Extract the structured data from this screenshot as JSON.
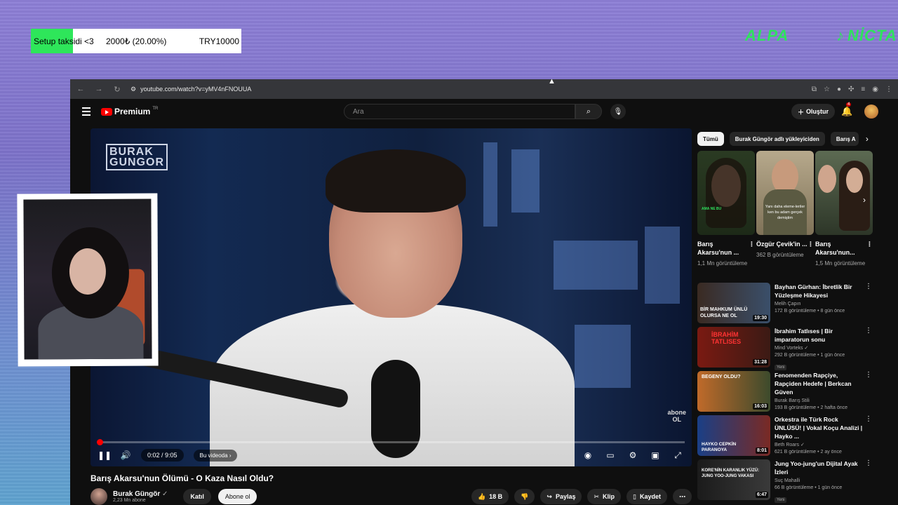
{
  "overlay": {
    "goal": {
      "label": "Setup taksidi <3",
      "amount": "2000₺ (20.00%)",
      "target": "TRY10000",
      "progress": 0.2,
      "color": "#2ee65a"
    },
    "kick_handle": "ALPA",
    "tiktok_handle": "NİCTA"
  },
  "browser": {
    "url": "youtube.com/watch?v=yMV4nFNOUUA"
  },
  "youtube": {
    "logo": "Premium",
    "logo_region": "TR",
    "search_placeholder": "Ara",
    "create_label": "Oluştur",
    "notifications_count": "4",
    "accent_color": "#ff0000"
  },
  "player": {
    "watermark_line1": "BURAK",
    "watermark_line2": "GUNGOR",
    "subscribe_badge_line1": "abone",
    "subscribe_badge_line2": "OL",
    "time": "0:02 / 9:05",
    "chapter": "Bu videoda",
    "progress": 0.004
  },
  "video_info": {
    "title": "Barış Akarsu'nun Ölümü - O Kaza Nasıl Oldu?",
    "channel": "Burak Güngör",
    "subscribers": "2,23 Mn abone",
    "join_label": "Katıl",
    "subscribe_label": "Abone ol",
    "likes": "18 B",
    "share_label": "Paylaş",
    "clip_label": "Klip",
    "save_label": "Kaydet"
  },
  "sidebar": {
    "chips": [
      "Tümü",
      "Burak Güngör adlı yükleyiciden",
      "Barış A"
    ],
    "shorts": [
      {
        "title": "Barış Akarsu'nun ...",
        "views": "1,1 Mn görüntüleme",
        "thumb_text": "AMA NE BU"
      },
      {
        "title": "Özgür Çevik'in ...",
        "views": "362 B görüntüleme",
        "thumb_text": "Yanı daha eleme-leriler ken bu adam gerçek demiştim"
      },
      {
        "title": "Barış Akarsu'nun...",
        "views": "1,5 Mn görüntüleme",
        "thumb_text": ""
      }
    ],
    "recommendations": [
      {
        "title": "Bayhan Gürhan: İbretlik Bir Yüzleşme Hikayesi",
        "channel": "Melih Çapın",
        "meta": "172 B görüntüleme • 8 gün önce",
        "duration": "19:30",
        "thumb_text": "BİR MAHKUM ÜNLÜ OLURSA NE OL",
        "is_new": false,
        "verified": false
      },
      {
        "title": "İbrahim Tatlıses | Bir imparatorun sonu",
        "channel": "Mind Vorteks",
        "meta": "292 B görüntüleme • 1 gün önce",
        "duration": "31:28",
        "thumb_text": "İBRAHİM TATLISES",
        "is_new": true,
        "verified": true
      },
      {
        "title": "Fenomenden Rapçiye, Rapçiden Hedefe | Berkcan Güven",
        "channel": "Burak Barış Stili",
        "meta": "193 B görüntüleme • 2 hafta önce",
        "duration": "16:03",
        "thumb_text": "BEGENY OLDU?",
        "is_new": false,
        "verified": false
      },
      {
        "title": "Orkestra ile Türk Rock ÜNLÜSÜ! | Vokal Koçu Analizi | Hayko ...",
        "channel": "Beth Roars",
        "meta": "621 B görüntüleme • 2 ay önce",
        "duration": "8:01",
        "thumb_text": "HAYKO CEPKİN PARANOYA",
        "is_new": false,
        "verified": true
      },
      {
        "title": "Jung Yoo-jung'un Dijital Ayak İzleri",
        "channel": "Suç Mahalli",
        "meta": "66 B görüntüleme • 1 gün önce",
        "duration": "6:47",
        "thumb_text": "KORE'NİN KARANLIK YÜZÜ: JUNG YOO-JUNG VAKASI",
        "is_new": true,
        "verified": false
      }
    ],
    "new_label": "Yeni"
  }
}
